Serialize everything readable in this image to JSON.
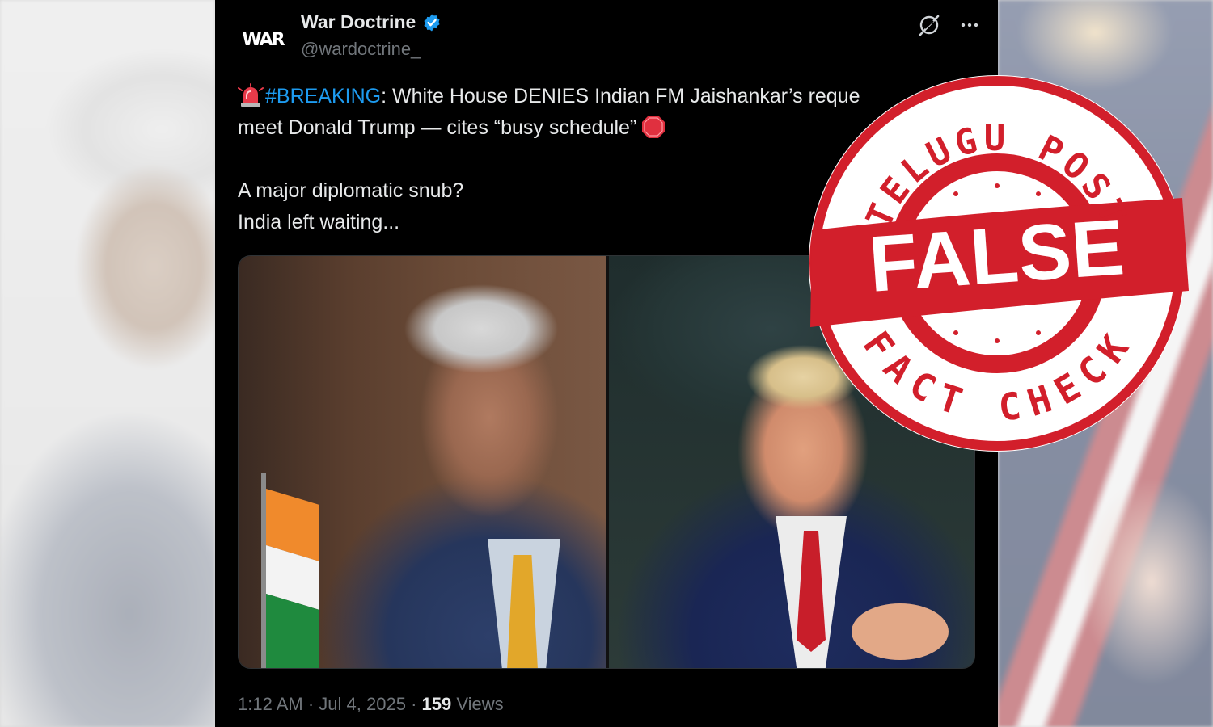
{
  "account": {
    "display_name": "War Doctrine",
    "handle": "@wardoctrine_",
    "avatar_text": "WAR",
    "verified": true
  },
  "tweet": {
    "hashtag": "#BREAKING",
    "line1_rest": ": White House DENIES Indian FM Jaishankar’s reque",
    "line2": "meet Donald Trump — cites “busy schedule”",
    "line3": "A major diplomatic snub?",
    "line4": "India left waiting...",
    "icons": [
      "siren-emoji",
      "stop-sign-emoji"
    ]
  },
  "media": {
    "images": [
      "photo-left",
      "photo-right"
    ]
  },
  "meta": {
    "time": "1:12 AM",
    "separator": "·",
    "date": "Jul 4, 2025",
    "views_count": "159",
    "views_label": "Views"
  },
  "stamp": {
    "top_text": "TELUGU POST",
    "center_text": "FALSE",
    "bottom_text": "FACT CHECK"
  },
  "colors": {
    "tweet_bg": "#000000",
    "text": "#e7e9ea",
    "secondary": "#71767b",
    "link": "#1d9bf0",
    "stamp_red": "#d21f2b"
  }
}
